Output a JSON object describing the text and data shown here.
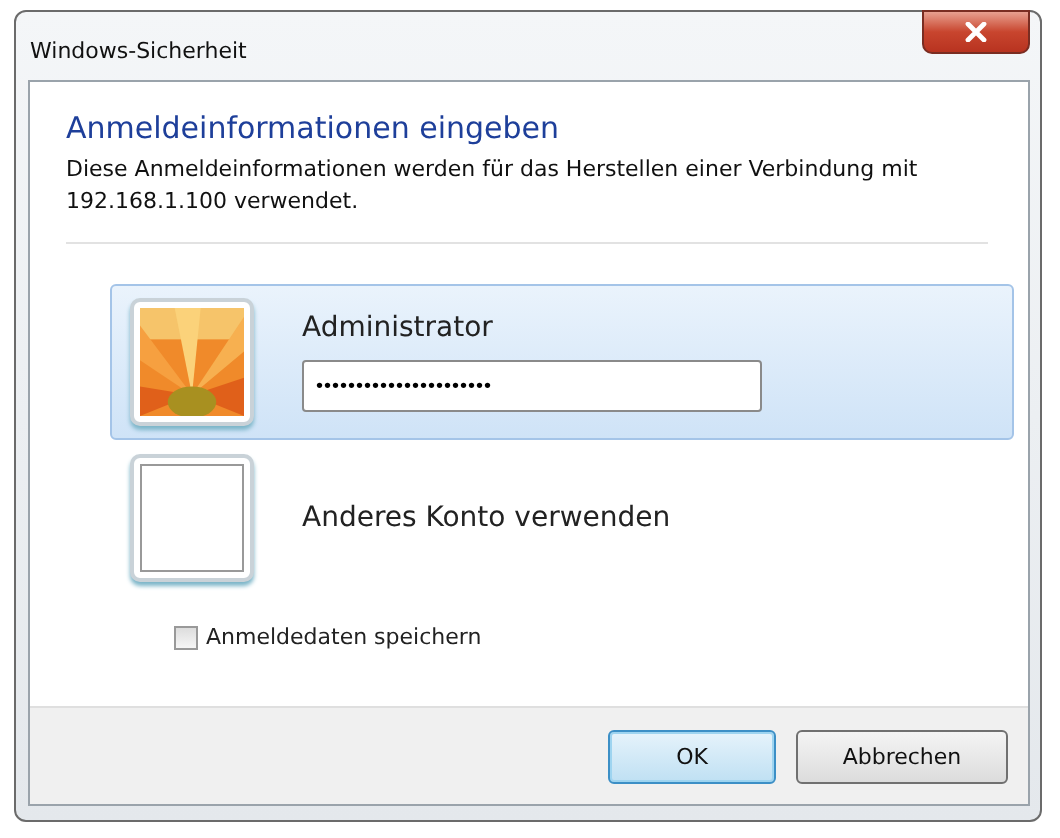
{
  "window": {
    "title": "Windows-Sicherheit"
  },
  "heading": "Anmeldeinformationen eingeben",
  "description": "Diese Anmeldeinformationen werden für das Herstellen einer Verbindung mit 192.168.1.100 verwendet.",
  "accounts": [
    {
      "name": "Administrator",
      "selected": true,
      "kind": "picture",
      "password": "••••••••••••••••••••••"
    },
    {
      "name": "Anderes Konto verwenden",
      "selected": false,
      "kind": "blank"
    }
  ],
  "remember": {
    "label": "Anmeldedaten speichern",
    "checked": false
  },
  "buttons": [
    {
      "label": "OK",
      "default": true
    },
    {
      "label": "Abbrechen",
      "default": false
    }
  ]
}
